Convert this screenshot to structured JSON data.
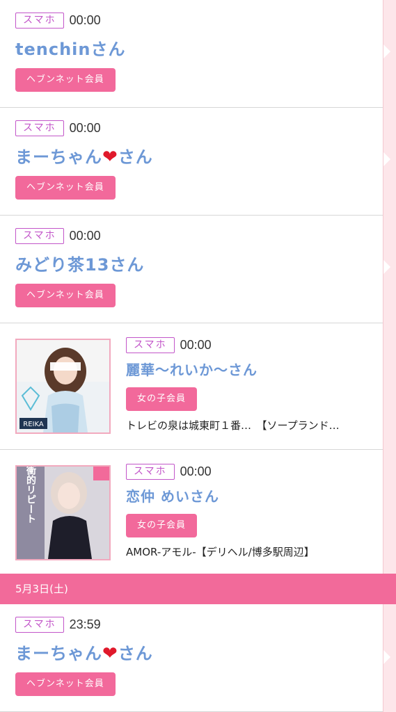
{
  "entries": [
    {
      "device": "スマホ",
      "time": "00:00",
      "name": "tenchinさん",
      "member": "ヘブンネット会員"
    },
    {
      "device": "スマホ",
      "time": "00:00",
      "name_pre": "まーちゃん",
      "name_post": "さん",
      "member": "ヘブンネット会員"
    },
    {
      "device": "スマホ",
      "time": "00:00",
      "name": "みどり茶13さん",
      "member": "ヘブンネット会員"
    },
    {
      "device": "スマホ",
      "time": "00:00",
      "name": "麗華〜れいか〜さん",
      "member": "女の子会員",
      "shop": "トレビの泉は城東町１番…　【ソープランド…",
      "thumb_text": "REIKA"
    },
    {
      "device": "スマホ",
      "time": "00:00",
      "name": "恋仲 めいさん",
      "member": "女の子会員",
      "shop": "AMOR-アモル-【デリヘル/博多駅周辺】",
      "thumb_text": "衝的リピート"
    }
  ],
  "date_header": "5月3日(土)",
  "entries_after": [
    {
      "device": "スマホ",
      "time": "23:59",
      "name_pre": "まーちゃん",
      "name_post": "さん",
      "member": "ヘブンネット会員"
    }
  ],
  "colors": {
    "accent_pink": "#f26a9a",
    "badge_purple": "#c255c9",
    "name_blue": "#6d98d6"
  }
}
